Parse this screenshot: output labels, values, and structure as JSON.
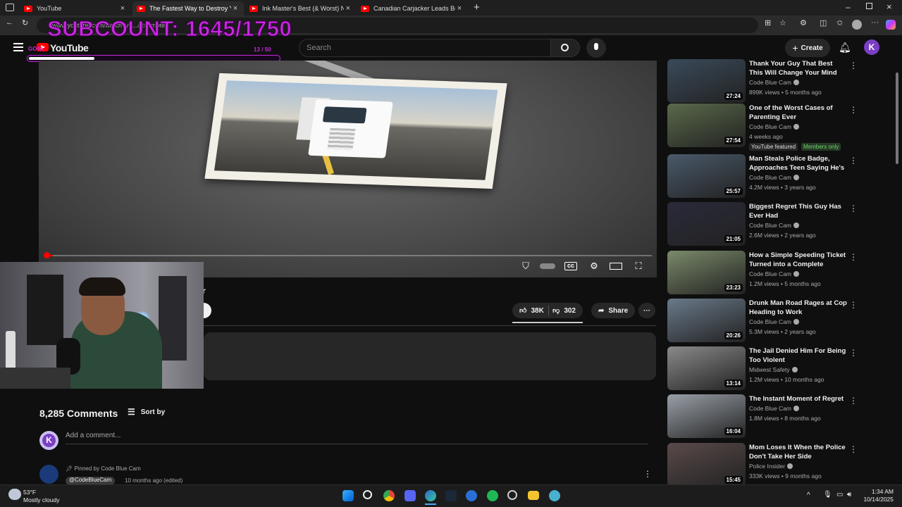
{
  "browser": {
    "tabs": [
      {
        "label": "YouTube",
        "active": false
      },
      {
        "label": "The Fastest Way to Destroy Your C",
        "active": true
      },
      {
        "label": "Ink Master's Best (& Worst) Neck",
        "active": false
      },
      {
        "label": "Canadian Carjacker Leads Border",
        "active": false
      }
    ],
    "new_tab": "+",
    "url": "www.youtube.com/watch?v=...&t=emote"
  },
  "overlay": {
    "subcount": "SUBCOUNT: 1645/1750",
    "goal_label": "GOAL",
    "goal_progress_text": "13 / 50",
    "goal_fraction": 0.26
  },
  "youtube": {
    "logo_text": "YouTube",
    "search_placeholder": "Search",
    "create_label": "Create",
    "avatar_letter": "K"
  },
  "player": {
    "progress_fraction": 0.012
  },
  "video": {
    "title_fragment": "r",
    "likes": "38K",
    "dislikes": "302",
    "share_label": "Share",
    "more": "···"
  },
  "comments": {
    "count_label": "8,285 Comments",
    "sort_label": "Sort by",
    "add_placeholder": "Add a comment...",
    "me_letter": "K",
    "pinned_by": "Pinned by Code Blue Cam",
    "pinned_user": "@CodeBlueCam",
    "pinned_time": "10 months ago (edited)",
    "more": "⋮"
  },
  "recommendations": [
    {
      "title": "Thank Your Guy That Best This Will Change Your Mind",
      "channel": "Code Blue Cam",
      "meta": "899K views • 5 months ago",
      "duration": "27:24",
      "thumb": "#3a4a5a"
    },
    {
      "title": "One of the Worst Cases of Parenting Ever",
      "channel": "Code Blue Cam",
      "meta": "4 weeks ago",
      "duration": "27:54",
      "thumb": "#5a6a4a",
      "badge1": "YouTube featured",
      "badge2": "Members only"
    },
    {
      "title": "Man Steals Police Badge, Approaches Teen Saying He's ...",
      "channel": "Code Blue Cam",
      "meta": "4.2M views • 3 years ago",
      "duration": "25:57",
      "thumb": "#4a5a6a"
    },
    {
      "title": "Biggest Regret This Guy Has Ever Had",
      "channel": "Code Blue Cam",
      "meta": "2.6M views • 2 years ago",
      "duration": "21:05",
      "thumb": "#2a2a3a"
    },
    {
      "title": "How a Simple Speeding Ticket Turned into a Complete Disaster",
      "channel": "Code Blue Cam",
      "meta": "1.2M views • 5 months ago",
      "duration": "23:23",
      "thumb": "#7a8a6a"
    },
    {
      "title": "Drunk Man Road Rages at Cop Heading to Work",
      "channel": "Code Blue Cam",
      "meta": "5.3M views • 2 years ago",
      "duration": "20:26",
      "thumb": "#6a7a8a"
    },
    {
      "title": "The Jail Denied Him For Being Too Violent",
      "channel": "Midwest Safety",
      "meta": "1.2M views • 10 months ago",
      "duration": "13:14",
      "thumb": "#8a8a8a"
    },
    {
      "title": "The Instant Moment of Regret",
      "channel": "Code Blue Cam",
      "meta": "1.8M views • 8 months ago",
      "duration": "16:04",
      "thumb": "#9aa0a8"
    },
    {
      "title": "Mom Loses It When the Police Don't Take Her Side",
      "channel": "Police Insider",
      "meta": "333K views • 9 months ago",
      "duration": "15:45",
      "thumb": "#5a4a4a"
    }
  ],
  "taskbar": {
    "temp": "53°F",
    "weather": "Mostly cloudy",
    "time": "1:34 AM",
    "date": "10/14/2025"
  }
}
